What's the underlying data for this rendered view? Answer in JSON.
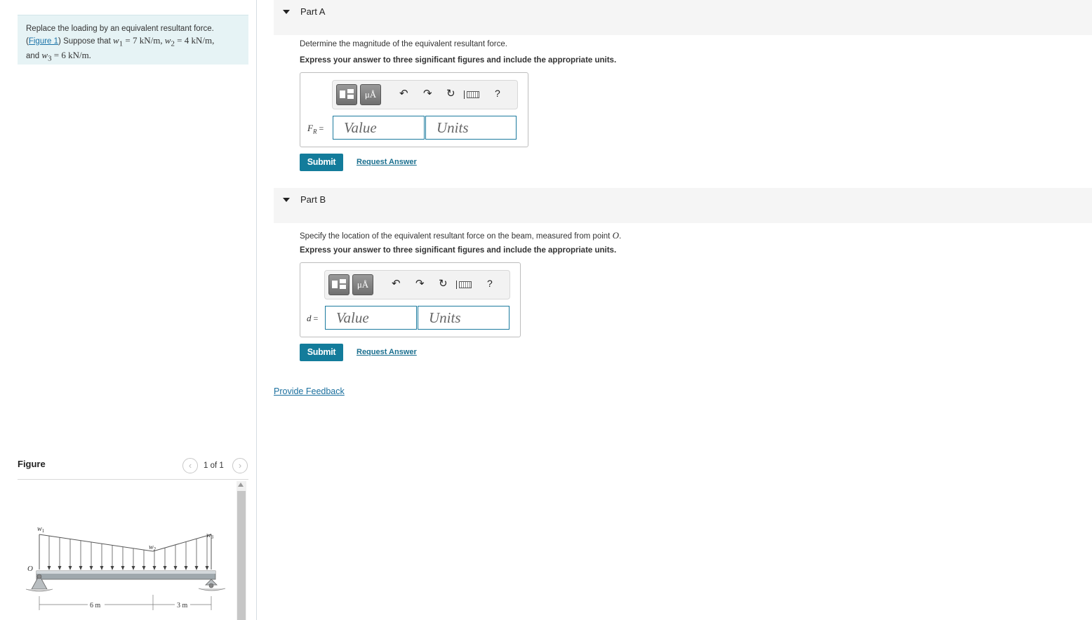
{
  "problem": {
    "text_1": "Replace the loading by an equivalent resultant force.",
    "figure_link": "Figure 1",
    "text_2": "Suppose that",
    "w1_var": "w",
    "w1_sub": "1",
    "w1_value": "= 7 kN/m,",
    "w2_var": "w",
    "w2_sub": "2",
    "w2_value": "= 4 kN/m,",
    "text_3": "and",
    "w3_var": "w",
    "w3_sub": "3",
    "w3_value": "= 6 kN/m."
  },
  "figure": {
    "title": "Figure",
    "counter": "1 of 1",
    "prev_glyph": "‹",
    "next_glyph": "›",
    "labels": {
      "w1": "w",
      "w1_sub": "1",
      "w2": "w",
      "w2_sub": "2",
      "w3": "w",
      "w3_sub": "3",
      "origin": "O",
      "dim1": "6 m",
      "dim2": "3 m"
    }
  },
  "parts": [
    {
      "title": "Part A",
      "prompt": "Determine the magnitude of the equivalent resultant force.",
      "instruction": "Express your answer to three significant figures and include the appropriate units.",
      "var_main": "F",
      "var_sub": "R",
      "var_eq": " =",
      "value_placeholder": "Value",
      "units_placeholder": "Units",
      "submit_label": "Submit",
      "request_label": "Request Answer"
    },
    {
      "title": "Part B",
      "prompt_text": "Specify the location of the equivalent resultant force on the beam, measured from point",
      "prompt_point": "O",
      "prompt_end": ".",
      "instruction": "Express your answer to three significant figures and include the appropriate units.",
      "var_main": "d",
      "var_eq": " =",
      "value_placeholder": "Value",
      "units_placeholder": "Units",
      "submit_label": "Submit",
      "request_label": "Request Answer"
    }
  ],
  "toolbar": {
    "symbols_label": "μÅ",
    "undo_glyph": "↶",
    "redo_glyph": "↷",
    "reset_glyph": "↻",
    "help_label": "?"
  },
  "feedback_label": "Provide Feedback"
}
